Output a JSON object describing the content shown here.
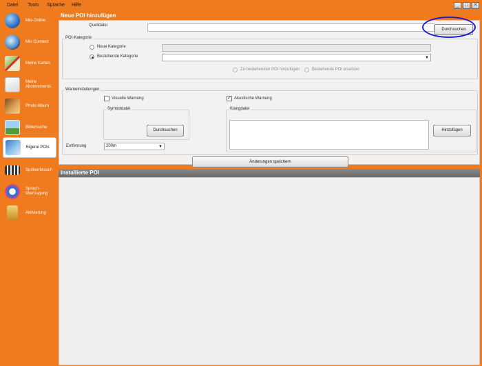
{
  "menu": [
    "Datei",
    "Tools",
    "Sprache",
    "Hilfe"
  ],
  "window_buttons": [
    "_",
    "□",
    "✕"
  ],
  "sidebar": {
    "items": [
      {
        "label": "Mio-Online",
        "icon": "globe-icon",
        "active": false
      },
      {
        "label": "Mio Connect",
        "icon": "magnifier-icon",
        "active": false
      },
      {
        "label": "Meine Karten",
        "icon": "map-icon",
        "active": false
      },
      {
        "label": "Meine Abonnements",
        "icon": "envelope-icon",
        "active": false
      },
      {
        "label": "Photo Album",
        "icon": "photo-album-icon",
        "active": false
      },
      {
        "label": "Bildersuche",
        "icon": "picture-search-icon",
        "active": false
      },
      {
        "label": "Eigene POIs",
        "icon": "poi-icon",
        "active": true
      },
      {
        "label": "Spritverbrauch",
        "icon": "fuel-icon",
        "active": false
      },
      {
        "label": "Sprach-übertragung",
        "icon": "speech-icon",
        "active": false
      },
      {
        "label": "Aktivierung",
        "icon": "lock-icon",
        "active": false
      }
    ]
  },
  "new_poi": {
    "title": "Neue POI hinzufügen",
    "source_label": "Quelldatei",
    "browse_label": "Durchsuchen",
    "category_group": "POI-Kategorie",
    "radio_new": "Neue Kategorie",
    "radio_existing": "Bestehende Kategorie",
    "add_to_existing": "Zu bestehenden POI hinzufügen",
    "replace_existing": "Bestehende POI ersetzen",
    "warning_group": "Warneinstellungen",
    "visual_warning": "Visuelle Warnung",
    "acoustic_warning": "Akustische Warnung",
    "symbol_file": "Symboldatei",
    "symbol_browse": "Durchsuchen",
    "sound_file": "Klangdatei",
    "add_label": "Hinzufügen",
    "distance_label": "Entfernung",
    "distance_value": "200m",
    "save_label": "Änderungen speichern"
  },
  "installed": {
    "title": "Installierte POI"
  },
  "colors": {
    "brand_orange": "#f07a1e",
    "highlight_blue": "#1b1bd0"
  }
}
